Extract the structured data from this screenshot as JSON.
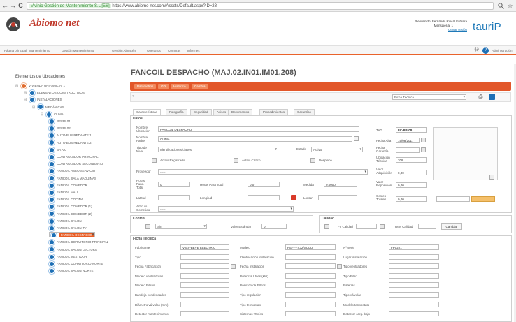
{
  "browser": {
    "back": "←",
    "forward": "→",
    "reload": "C",
    "cert_label": "Vivinio Gestión de Mantenimiento S.L [ES]",
    "url": "https://www.abiomo-net.com/Assets/Default.aspx?ID=28",
    "search_icon": "magnifier-icon",
    "star_icon": "star-icon"
  },
  "brand": {
    "logo_text": "Abiomo net",
    "partner_text": "tauriP"
  },
  "user": {
    "line1": "Bienvenido: Fernando Rincal Fabrera",
    "line2": "Mensajería_1",
    "line3": "Cerrar sesión"
  },
  "menu": {
    "items": [
      "Página principal",
      "Mantenimiento",
      "Gestión Mantenimiento",
      "Gestión Almacén",
      "Operarios",
      "Compras",
      "Informes"
    ],
    "admin": "Administración"
  },
  "tree": {
    "title": "Elementos de Ubicaciones",
    "nodes": [
      {
        "label": "VIVIENDA UNIFAMILIA_1",
        "level": 0,
        "color": "orange"
      },
      {
        "label": "ELEMENTOS CONSTRUCTIVOS",
        "level": 1,
        "color": "blue"
      },
      {
        "label": "INSTALACIONES",
        "level": 1,
        "color": "blue"
      },
      {
        "label": "MECÁNICAS",
        "level": 2,
        "color": "blue"
      },
      {
        "label": "CLIMA",
        "level": 3,
        "color": "blue"
      },
      {
        "label": "REFRI 01",
        "level": 4,
        "color": "blue"
      },
      {
        "label": "REFRI 02",
        "level": 4,
        "color": "blue"
      },
      {
        "label": "AUTO-BUS REDANTE 1",
        "level": 4,
        "color": "blue"
      },
      {
        "label": "AUTO-BUS REDANTE 2",
        "level": 4,
        "color": "blue"
      },
      {
        "label": "BA A/C",
        "level": 4,
        "color": "blue"
      },
      {
        "label": "CONTROLADOR PRINCIPAL",
        "level": 4,
        "color": "blue"
      },
      {
        "label": "CONTROLADOR SECUNDARIO",
        "level": 4,
        "color": "blue"
      },
      {
        "label": "FANCOIL ASEO SERVICIO",
        "level": 4,
        "color": "blue"
      },
      {
        "label": "FANCOIL SALA MAQUINAS",
        "level": 4,
        "color": "blue"
      },
      {
        "label": "FANCOIL COMEDOR",
        "level": 4,
        "color": "blue"
      },
      {
        "label": "FANCOIL HALL",
        "level": 4,
        "color": "blue"
      },
      {
        "label": "FANCOIL COCINA",
        "level": 4,
        "color": "blue"
      },
      {
        "label": "FANCOIL COMEDOR (1)",
        "level": 4,
        "color": "blue"
      },
      {
        "label": "FANCOIL COMEDOR (2)",
        "level": 4,
        "color": "blue"
      },
      {
        "label": "FANCOIL SALON",
        "level": 4,
        "color": "blue"
      },
      {
        "label": "FANCOIL SALON TV",
        "level": 4,
        "color": "blue"
      },
      {
        "label": "FANCOIL DESPACHO",
        "level": 4,
        "color": "blue",
        "selected": true
      },
      {
        "label": "FANCOIL DORMITORIO PRINCIPAL",
        "level": 4,
        "color": "blue"
      },
      {
        "label": "FANCOIL SALON LECTURA",
        "level": 4,
        "color": "blue"
      },
      {
        "label": "FANCOIL VESTIDOR",
        "level": 4,
        "color": "blue"
      },
      {
        "label": "FANCOIL DORMITORIO NORTE",
        "level": 4,
        "color": "blue"
      },
      {
        "label": "FANCOIL SALON NORTE",
        "level": 4,
        "color": "blue"
      }
    ]
  },
  "main": {
    "title": "FANCOIL DESPACHO (MAJ.02.IN01.IM01.208)",
    "action_buttons": [
      "Parámetros",
      "OTs",
      "Histórico",
      "Cambia"
    ],
    "ficha_select": "Ficha Técnica",
    "tabs": [
      "Características",
      "Fotografía",
      "Seguridad",
      "Avisos",
      "Documentos",
      "Procedimientos",
      "Garantías"
    ],
    "datos_title": "Datos",
    "fields": {
      "nombre_label": "Nombre Ubicación",
      "nombre_value": "FANCOIL DESPACHO",
      "nombre_padre_label": "Nombre Padre",
      "nombre_padre_value": "CLIMA",
      "tipo_label": "Tipo de Nivel",
      "tipo_value": "Identificaciones/clases",
      "estado_label": "Estado",
      "estado_value": "Activo",
      "activo_reg_label": "Activo Registrado",
      "activo_cfr_label": "Activo Crítico",
      "despiece_label": "Despiece",
      "proveedor_label": "Proveedor",
      "proveedor_value": "-----",
      "horas_label": "Horas Func. Total",
      "horas_value": "0",
      "horas_para_label": "Horas Para Total",
      "horas_para_value": "0,0",
      "medida_label": "Medida",
      "medida_value": "0,0000",
      "latitud_label": "Latitud",
      "longitud_label": "Longitud",
      "lontan_label": "Lontan",
      "articulo_label": "Artículo Cometido",
      "articulo_value": "-----",
      "tag_label": "TAG",
      "tag_value": "FC-PB-08",
      "fecha_alta_label": "Fecha Alta",
      "fecha_alta_value": "15/08/2017",
      "fecha_garantia_label": "Fecha Garantía",
      "ubicacion_label": "Ubicación Técnica",
      "ubicacion_value": "208",
      "valor_adq_label": "Valor Adquisición",
      "valor_adq_value": "0,00",
      "valor_rep_label": "Valor Reposición",
      "valor_rep_value": "0,00",
      "costes_label": "Costes Totales",
      "costes_value": "0,00"
    },
    "control_title": "Control",
    "control_select": "Sin",
    "valor_estandar_label": "Valor Estándar",
    "valor_estandar_value": "0",
    "calidad_title": "Calidad",
    "calidad_codigo_label": "Fr. Calidad",
    "rev_calidad_label": "Rev. Calidad",
    "calidad_btn": "Cambiar",
    "ficha_title": "Ficha Técnica",
    "ficha_rows": [
      {
        "l1": "Fabricante",
        "v1": "VIES-BEVE ELECTRIC",
        "l2": "Modelo",
        "v2": "REFI-FX32/SOLO",
        "l3": "Nº serie",
        "v3": "FP0221"
      },
      {
        "l1": "Tipo",
        "v1": "",
        "l2": "Identificación instalación",
        "v2": "",
        "l3": "Lugar instalación",
        "v3": ""
      },
      {
        "l1": "Fecha Fabricación",
        "v1": "",
        "l2": "Fecha Instalación",
        "v2": "",
        "l3": "Tipo ventiladores",
        "v3": ""
      },
      {
        "l1": "Modelo ventiladores",
        "v1": "",
        "l2": "Potencia Útiles (kW)",
        "v2": "",
        "l3": "Tipo Filtro",
        "v3": ""
      },
      {
        "l1": "Modelo Filtros",
        "v1": "",
        "l2": "Posición de Filtros",
        "v2": "",
        "l3": "Baterías",
        "v3": ""
      },
      {
        "l1": "Bandeja condensados",
        "v1": "",
        "l2": "Tipo regulación",
        "v2": "",
        "l3": "Tipo válvulas",
        "v3": ""
      },
      {
        "l1": "Diámetro válvulas (mm)",
        "v1": "",
        "l2": "Tipo termostato",
        "v2": "",
        "l3": "Modelo termostato",
        "v3": ""
      },
      {
        "l1": "Detector mantenimiento",
        "v1": "",
        "l2": "Sistemas Vacíos",
        "v2": "",
        "l3": "Detector carg. bajo",
        "v3": ""
      }
    ]
  }
}
